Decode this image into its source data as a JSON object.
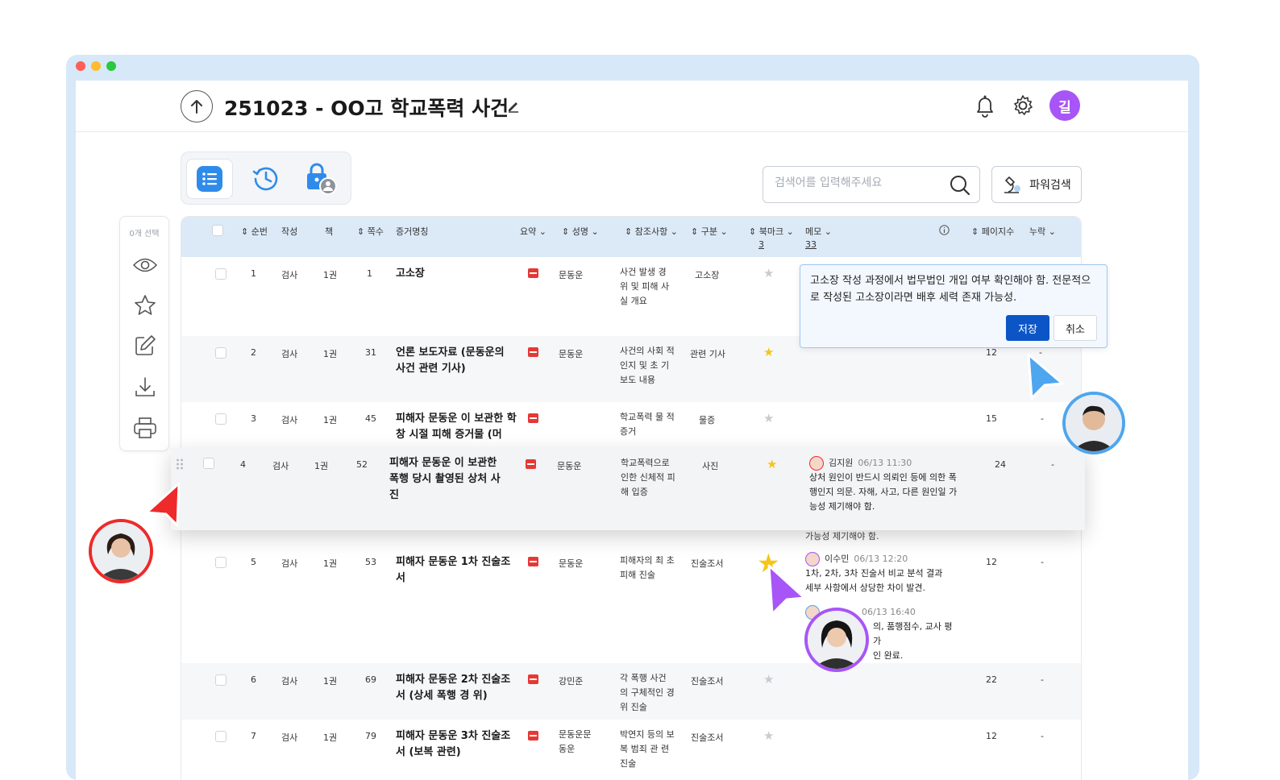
{
  "window": {
    "traffic": [
      "#ff5f57",
      "#febc2e",
      "#28c840"
    ]
  },
  "header": {
    "title": "251023 - OO고 학교폭력 사건",
    "user_initial": "길",
    "user_color": "#a855f7"
  },
  "toolbar": {
    "search_placeholder": "검색어를 입력해주세요",
    "power_search": "파워검색"
  },
  "side": {
    "selected_count": "0개 선택"
  },
  "columns": {
    "seq": "순번",
    "author": "작성",
    "book": "책",
    "pages": "쪽수",
    "name": "증거명칭",
    "summary": "요약",
    "person": "성명",
    "ref": "참조사항",
    "category": "구분",
    "bookmark": "북마크",
    "bookmark_count": "3",
    "memo": "메모",
    "memo_count": "33",
    "page_count": "페이지수",
    "missing": "누락"
  },
  "rows": [
    {
      "seq": "1",
      "author": "검사",
      "book": "1권",
      "page": "1",
      "name": "고소장",
      "person": "문동운",
      "ref": "사건 발생 경 위 및 피해 사 실 개요",
      "category": "고소장",
      "starred": false,
      "pages": "",
      "missing": ""
    },
    {
      "seq": "2",
      "author": "검사",
      "book": "1권",
      "page": "31",
      "name": "언론 보도자료 (문동운의 사건 관련 기사)",
      "person": "문동운",
      "ref": "사건의 사회 적 인지 및 초 기 보도 내용",
      "category": "관련 기사",
      "starred": true,
      "pages": "12",
      "missing": "-"
    },
    {
      "seq": "3",
      "author": "검사",
      "book": "1권",
      "page": "45",
      "name": "피해자 문동운 이 보관한 학창 시절 피해 증거물 (머",
      "person": "",
      "ref": "학교폭력 물 적 증거",
      "category": "물증",
      "starred": false,
      "pages": "15",
      "missing": "-"
    },
    {
      "seq": "4",
      "author": "검사",
      "book": "1권",
      "page": "52",
      "name": "피해자 문동운 이 보관한 폭행 당시 촬영된 상처 사진",
      "person": "문동운",
      "ref": "학교폭력으로 인한 신체적 피해 입증",
      "category": "사진",
      "starred": true,
      "pages": "24",
      "missing": "-"
    },
    {
      "seq": "5",
      "author": "검사",
      "book": "1권",
      "page": "53",
      "name": "피해자 문동운 1차 진술조서",
      "person": "문동운",
      "ref": "피해자의 최 초 피해 진술",
      "category": "진술조서",
      "starred": true,
      "pages": "12",
      "missing": "-"
    },
    {
      "seq": "6",
      "author": "검사",
      "book": "1권",
      "page": "69",
      "name": "피해자 문동운 2차 진술조서 (상세 폭행 경 위)",
      "person": "강민준",
      "ref": "각 폭행 사건 의 구체적인 경위 진술",
      "category": "진술조서",
      "starred": false,
      "pages": "22",
      "missing": "-"
    },
    {
      "seq": "7",
      "author": "검사",
      "book": "1권",
      "page": "79",
      "name": "피해자 문동운 3차 진술조서 (보복 관련)",
      "person": "문동운문 동운",
      "ref": "박연지 등의 보복 범죄 관 련 진술",
      "category": "진술조서",
      "starred": false,
      "pages": "12",
      "missing": "-"
    }
  ],
  "memo_editor": {
    "text": "고소장 작성 과정에서 법무법인 개입 여부 확인해야 함. 전문적으로 작성된 고소장이라면 배후 세력 존재 가능성.",
    "save": "저장",
    "cancel": "취소"
  },
  "comments": {
    "row4": {
      "author": "김지원",
      "time": "06/13 11:30",
      "text": "상처 원인이 반드시 의뢰인 등에 의한 폭행인지 의문. 자해, 사고, 다른 원인일 가능성 제기해야 함."
    },
    "row4_overflow": "가능성 제기해야 함.",
    "row5a": {
      "author": "이수민",
      "time": "06/13 12:20",
      "text": "1차, 2차, 3차 진술서 비교 분석 결과 세부 사항에서 상당한 차이 발견."
    },
    "row5b": {
      "time": "06/13 16:40",
      "line1": "의, 품행점수, 교사 평가",
      "line2": "인 완료."
    }
  },
  "collaborators": {
    "blue": "#4ea6ef",
    "red": "#ee2a2a",
    "purple": "#a855f7"
  },
  "star_color": "#f5c518"
}
